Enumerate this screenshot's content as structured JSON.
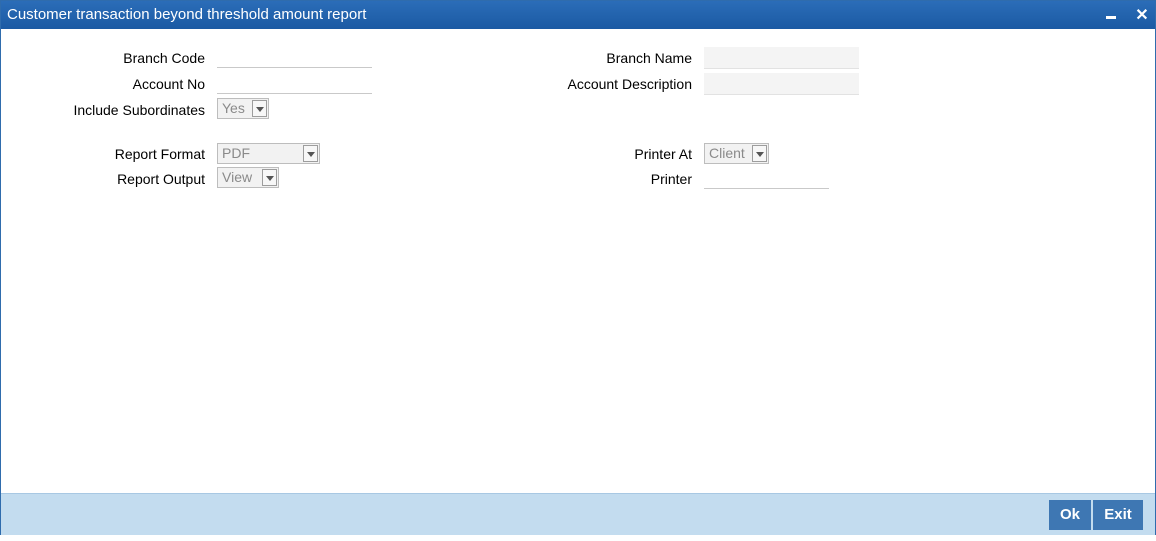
{
  "window": {
    "title": "Customer transaction beyond threshold amount report",
    "minimize_icon": "minimize-icon",
    "close_glyph": "✕"
  },
  "form": {
    "branch_code_label": "Branch Code",
    "branch_code_value": "",
    "branch_name_label": "Branch Name",
    "branch_name_value": "",
    "account_no_label": "Account No",
    "account_no_value": "",
    "account_description_label": "Account Description",
    "account_description_value": "",
    "include_subordinates_label": "Include Subordinates",
    "include_subordinates_value": "Yes",
    "report_format_label": "Report Format",
    "report_format_value": "PDF",
    "report_output_label": "Report Output",
    "report_output_value": "View",
    "printer_at_label": "Printer At",
    "printer_at_value": "Client",
    "printer_label": "Printer",
    "printer_value": ""
  },
  "footer": {
    "ok_label": "Ok",
    "exit_label": "Exit"
  },
  "colors": {
    "titlebar": "#1f5fa8",
    "footer": "#c3dcef",
    "button": "#3e77b3"
  }
}
